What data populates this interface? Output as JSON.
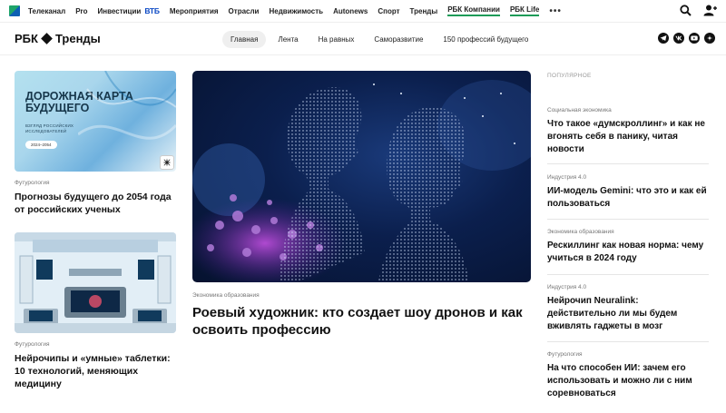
{
  "topnav": {
    "items": [
      {
        "label": "Телеканал"
      },
      {
        "label": "Pro"
      },
      {
        "label": "Инвестиции"
      },
      {
        "label": "Мероприятия"
      },
      {
        "label": "Отрасли"
      },
      {
        "label": "Недвижимость"
      },
      {
        "label": "Autonews"
      },
      {
        "label": "Спорт"
      },
      {
        "label": "Тренды"
      },
      {
        "label": "РБК Компании"
      },
      {
        "label": "РБК Life"
      }
    ],
    "vtb_label": "ВТБ",
    "more_label": "•••",
    "icons": [
      "search-icon",
      "user-add-icon"
    ]
  },
  "header": {
    "brand_left": "РБК",
    "brand_right": "Тренды",
    "tabs": [
      {
        "label": "Главная",
        "active": true
      },
      {
        "label": "Лента"
      },
      {
        "label": "На равных"
      },
      {
        "label": "Саморазвитие"
      },
      {
        "label": "150 профессий будущего"
      }
    ],
    "social_icons": [
      "telegram-icon",
      "vk-icon",
      "youtube-icon",
      "zen-icon"
    ]
  },
  "left": {
    "card1": {
      "img_title": "ДОРОЖНАЯ КАРТА БУДУЩЕГО",
      "img_subtitle": "ВЗГЛЯД РОССИЙСКИХ ИССЛЕДОВАТЕЛЕЙ",
      "img_badge": "2024–2054",
      "tag": "Футурология",
      "headline": "Прогнозы будущего до 2054 года от российских ученых"
    },
    "card2": {
      "tag": "Футурология",
      "headline": "Нейрочипы и «умные» таблетки: 10 технологий, меняющих медицину"
    }
  },
  "center": {
    "tag": "Экономика образования",
    "headline": "Роевый художник: кто создает шоу дронов и как освоить профессию"
  },
  "right": {
    "title": "ПОПУЛЯРНОЕ",
    "items": [
      {
        "tag": "Социальная экономика",
        "headline": "Что такое «думскроллинг» и как не вгонять себя в панику, читая новости"
      },
      {
        "tag": "Индустрия 4.0",
        "headline": "ИИ-модель Gemini: что это и как ей пользоваться"
      },
      {
        "tag": "Экономика образования",
        "headline": "Рескиллинг как новая норма: чему учиться в 2024 году"
      },
      {
        "tag": "Индустрия 4.0",
        "headline": "Нейрочип Neuralink: действительно ли мы будем вживлять гаджеты в мозг"
      },
      {
        "tag": "Футурология",
        "headline": "На что способен ИИ: зачем его использовать и можно ли с ним соревноваться"
      }
    ]
  },
  "colors": {
    "accent_green": "#1a9b57",
    "vtb_blue": "#0a48c4",
    "hero_bg": "#0b1f4d"
  }
}
